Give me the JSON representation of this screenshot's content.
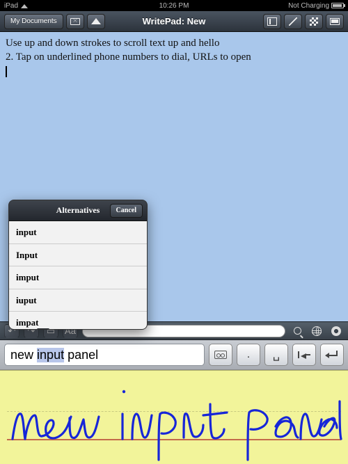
{
  "status": {
    "device": "iPad",
    "time": "10:26 PM",
    "charge": "Not Charging"
  },
  "nav": {
    "back": "My Documents",
    "title": "WritePad: New"
  },
  "doc": {
    "line1": "Use up and down strokes to scroll text up and hello",
    "line2": "2. Tap on underlined phone numbers to dial, URLs to open"
  },
  "alternatives": {
    "title": "Alternatives",
    "cancel": "Cancel",
    "items": [
      "input",
      "Input",
      "imput",
      "iuput",
      "impat"
    ]
  },
  "recognized": {
    "w0": "new",
    "w1": "input",
    "w2": "panel",
    "period": "."
  },
  "buttons": {
    "space": "␣"
  },
  "handwriting": {
    "text": "new input panel"
  }
}
